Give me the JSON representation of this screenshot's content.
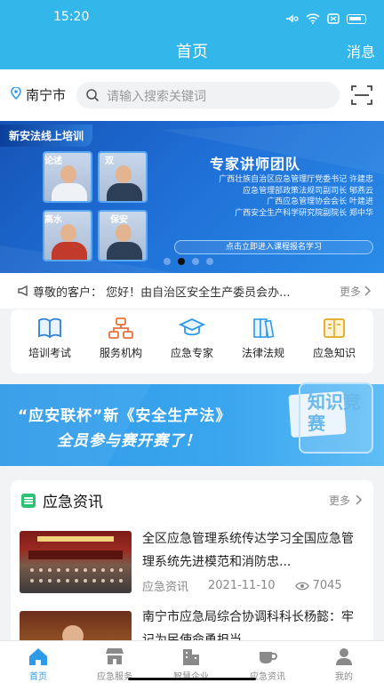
{
  "status_bar": {
    "time": "15:20"
  },
  "header": {
    "title": "首页",
    "messages_label": "消息"
  },
  "search": {
    "location": "南宁市",
    "placeholder": "请输入搜索关键词"
  },
  "banner": {
    "tag": "新安法线上培训",
    "team_title": "专家讲师团队",
    "team_members": [
      "广西壮族自治区应急管理厅党委书记  许建忠",
      "应急管理部政策法规司副司长  郇燕云",
      "广西应急管理协会会长  叶建进",
      "广西安全生产科学研究院副院长  郑中华"
    ],
    "cta": "点击立即进入课程报名学习",
    "photo_captions": [
      "论述",
      "双",
      "高水",
      "保安"
    ],
    "active_slide": 1,
    "slide_count": 4
  },
  "notice": {
    "text": "尊敬的客户：  您好！由自治区安全生产委员会办...",
    "more": "更多"
  },
  "quick_links": [
    {
      "label": "培训考试",
      "icon": "book-icon"
    },
    {
      "label": "服务机构",
      "icon": "org-chart-icon"
    },
    {
      "label": "应急专家",
      "icon": "graduation-cap-icon"
    },
    {
      "label": "法律法规",
      "icon": "law-books-icon"
    },
    {
      "label": "应急知识",
      "icon": "open-book-icon"
    }
  ],
  "promo": {
    "line1": "“应安联杯”新《安全生产法》",
    "line2": "全员参与赛开赛了！",
    "badge": "知识竞赛"
  },
  "news": {
    "title": "应急资讯",
    "more": "更多",
    "articles": [
      {
        "title": "全区应急管理系统传达学习全国应急管理系统先进模范和消防忠...",
        "category": "应急资讯",
        "date": "2021-11-10",
        "views": "7045"
      },
      {
        "title": "南宁市应急局综合协调科科长杨懿：牢记为民使命勇担当",
        "category": "",
        "date": "",
        "views": ""
      }
    ]
  },
  "tabbar": [
    {
      "label": "首页",
      "icon": "home-icon",
      "active": true
    },
    {
      "label": "应急服务",
      "icon": "shop-icon",
      "active": false
    },
    {
      "label": "智慧企业",
      "icon": "building-icon",
      "active": false
    },
    {
      "label": "应急资讯",
      "icon": "cup-icon",
      "active": false
    },
    {
      "label": "我的",
      "icon": "user-icon",
      "active": false
    }
  ],
  "colors": {
    "brand": "#33b6ea",
    "accent": "#2f9be8",
    "news_icon": "#2bc271"
  }
}
